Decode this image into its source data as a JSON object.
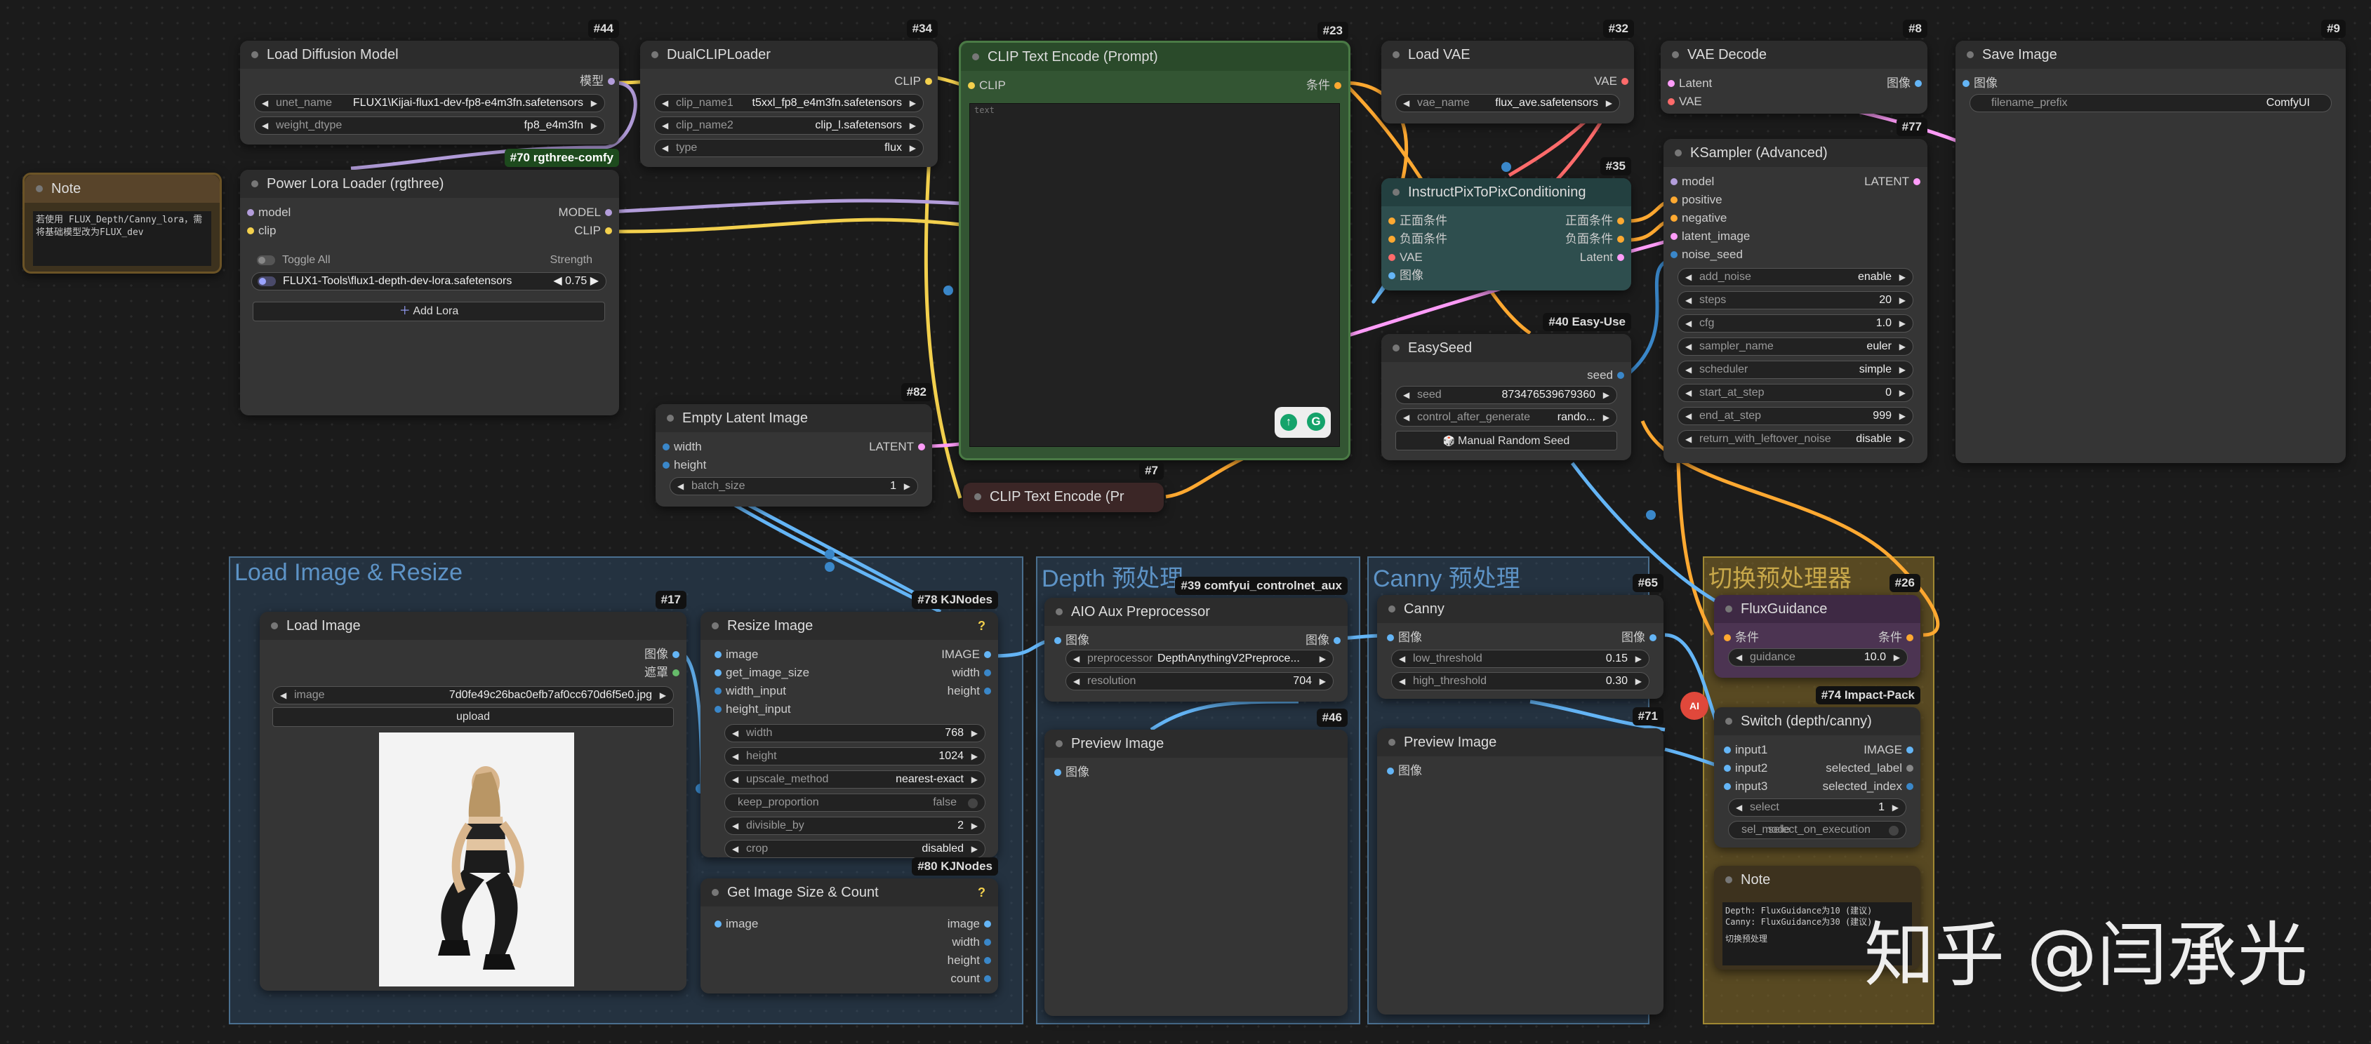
{
  "colors": {
    "accent": "#5a9be8",
    "clip": "#f3d04d",
    "model": "#b39ddb",
    "vae": "#ff6b6b",
    "latent": "#ff9cf9",
    "conditioning": "#ffa931",
    "image": "#64b5f6"
  },
  "groups": {
    "load_image": "Load Image & Resize",
    "depth": "Depth 预处理",
    "canny": "Canny 预处理",
    "switch": "切换预处理器"
  },
  "nodes": {
    "load_diffusion": {
      "title": "Load Diffusion Model",
      "id": "#44",
      "out_model": "模型",
      "unet_name_label": "unet_name",
      "unet_name": "FLUX1\\Kijai-flux1-dev-fp8-e4m3fn.safetensors",
      "weight_dtype_label": "weight_dtype",
      "weight_dtype": "fp8_e4m3fn"
    },
    "dualclip": {
      "title": "DualCLIPLoader",
      "id": "#34",
      "out_clip": "CLIP",
      "clip_name1_label": "clip_name1",
      "clip_name1": "t5xxl_fp8_e4m3fn.safetensors",
      "clip_name2_label": "clip_name2",
      "clip_name2": "clip_l.safetensors",
      "type_label": "type",
      "type": "flux"
    },
    "clip_text": {
      "title": "CLIP Text Encode (Prompt)",
      "id": "#23",
      "in_clip": "CLIP",
      "out": "条件",
      "placeholder": "text"
    },
    "load_vae": {
      "title": "Load VAE",
      "id": "#32",
      "out_vae": "VAE",
      "vae_name_label": "vae_name",
      "vae_name": "flux_ave.safetensors"
    },
    "vae_decode": {
      "title": "VAE Decode",
      "id": "#8",
      "in_latent": "Latent",
      "in_vae": "VAE",
      "out": "图像"
    },
    "save_image": {
      "title": "Save Image",
      "id": "#9",
      "in": "图像",
      "prefix_label": "filename_prefix",
      "prefix": "ComfyUI"
    },
    "note1": {
      "title": "Note",
      "text": "若使用 FLUX_Depth/Canny_lora，需将基础模型改为FLUX_dev"
    },
    "power_lora": {
      "title": "Power Lora Loader (rgthree)",
      "id": "#70 rgthree-comfy",
      "in_model": "model",
      "in_clip": "clip",
      "out_model": "MODEL",
      "out_clip": "CLIP",
      "toggle_all": "Toggle All",
      "strength": "Strength",
      "lora_name": "FLUX1-Tools\\flux1-depth-dev-lora.safetensors",
      "lora_strength": "0.75",
      "add_lora": "Add Lora"
    },
    "instruct": {
      "title": "InstructPixToPixConditioning",
      "id": "#35",
      "in_pos": "正面条件",
      "in_neg": "负面条件",
      "in_vae": "VAE",
      "in_img": "图像",
      "out_pos": "正面条件",
      "out_neg": "负面条件",
      "out_latent": "Latent"
    },
    "ksampler": {
      "title": "KSampler (Advanced)",
      "id": "#77",
      "in_model": "model",
      "in_pos": "positive",
      "in_neg": "negative",
      "in_latent": "latent_image",
      "in_seed": "noise_seed",
      "out": "LATENT",
      "widgets": [
        {
          "label": "add_noise",
          "value": "enable"
        },
        {
          "label": "steps",
          "value": "20"
        },
        {
          "label": "cfg",
          "value": "1.0"
        },
        {
          "label": "sampler_name",
          "value": "euler"
        },
        {
          "label": "scheduler",
          "value": "simple"
        },
        {
          "label": "start_at_step",
          "value": "0"
        },
        {
          "label": "end_at_step",
          "value": "999"
        },
        {
          "label": "return_with_leftover_noise",
          "value": "disable"
        }
      ]
    },
    "easyseed": {
      "title": "EasySeed",
      "id": "#40 Easy-Use",
      "out": "seed",
      "seed_label": "seed",
      "seed": "873476539679360",
      "control_label": "control_after_generate",
      "control": "rando...",
      "button": "Manual Random Seed"
    },
    "empty_latent": {
      "title": "Empty Latent Image",
      "id": "#82",
      "in_width": "width",
      "in_height": "height",
      "out": "LATENT",
      "batch_label": "batch_size",
      "batch": "1"
    },
    "clip_text2": {
      "title": "CLIP Text Encode (Pr",
      "id": "#7"
    },
    "load_image": {
      "title": "Load Image",
      "id": "#17",
      "out_img": "图像",
      "out_mask": "遮罩",
      "image_label": "image",
      "image": "7d0fe49c26bac0efb7af0cc670d6f5e0.jpg",
      "upload": "upload"
    },
    "resize": {
      "title": "Resize Image",
      "id": "#78 KJNodes",
      "help": "?",
      "in_image": "image",
      "in_gis": "get_image_size",
      "in_wi": "width_input",
      "in_hi": "height_input",
      "out_image": "IMAGE",
      "out_w": "width",
      "out_h": "height",
      "widgets": [
        {
          "label": "width",
          "value": "768"
        },
        {
          "label": "height",
          "value": "1024"
        },
        {
          "label": "upscale_method",
          "value": "nearest-exact"
        },
        {
          "label": "keep_proportion",
          "value": "false"
        },
        {
          "label": "divisible_by",
          "value": "2"
        },
        {
          "label": "crop",
          "value": "disabled"
        }
      ]
    },
    "get_size": {
      "title": "Get Image Size & Count",
      "id": "#80 KJNodes",
      "help": "?",
      "in": "image",
      "out_image": "image",
      "out_w": "width",
      "out_h": "height",
      "out_c": "count"
    },
    "aio": {
      "title": "AIO Aux Preprocessor",
      "id": "#39 comfyui_controlnet_aux",
      "in": "图像",
      "out": "图像",
      "pre_label": "preprocessor",
      "pre": "DepthAnythingV2Preproce...",
      "res_label": "resolution",
      "res": "704"
    },
    "preview1": {
      "title": "Preview Image",
      "id": "#46",
      "in": "图像"
    },
    "canny": {
      "title": "Canny",
      "id": "#65",
      "in": "图像",
      "out": "图像",
      "low_label": "low_threshold",
      "low": "0.15",
      "high_label": "high_threshold",
      "high": "0.30"
    },
    "preview2": {
      "title": "Preview Image",
      "id": "#71",
      "in": "图像"
    },
    "flux_guidance": {
      "title": "FluxGuidance",
      "id": "#26",
      "in": "条件",
      "out": "条件",
      "g_label": "guidance",
      "g": "10.0"
    },
    "switch": {
      "title": "Switch (depth/canny)",
      "id": "#74 Impact-Pack",
      "in1": "input1",
      "in2": "input2",
      "in3": "input3",
      "out_image": "IMAGE",
      "out_label": "selected_label",
      "out_index": "selected_index",
      "select_label": "select",
      "select": "1",
      "mode_label": "sel_mode",
      "mode_value": "select_on_execution"
    },
    "note2": {
      "title": "Note",
      "line1": "Depth: FluxGuidance为10 (建议)",
      "line2": "Canny: FluxGuidance为30 (建议)",
      "line3": "切换预处理"
    }
  },
  "watermark": "知乎 @闫承光"
}
